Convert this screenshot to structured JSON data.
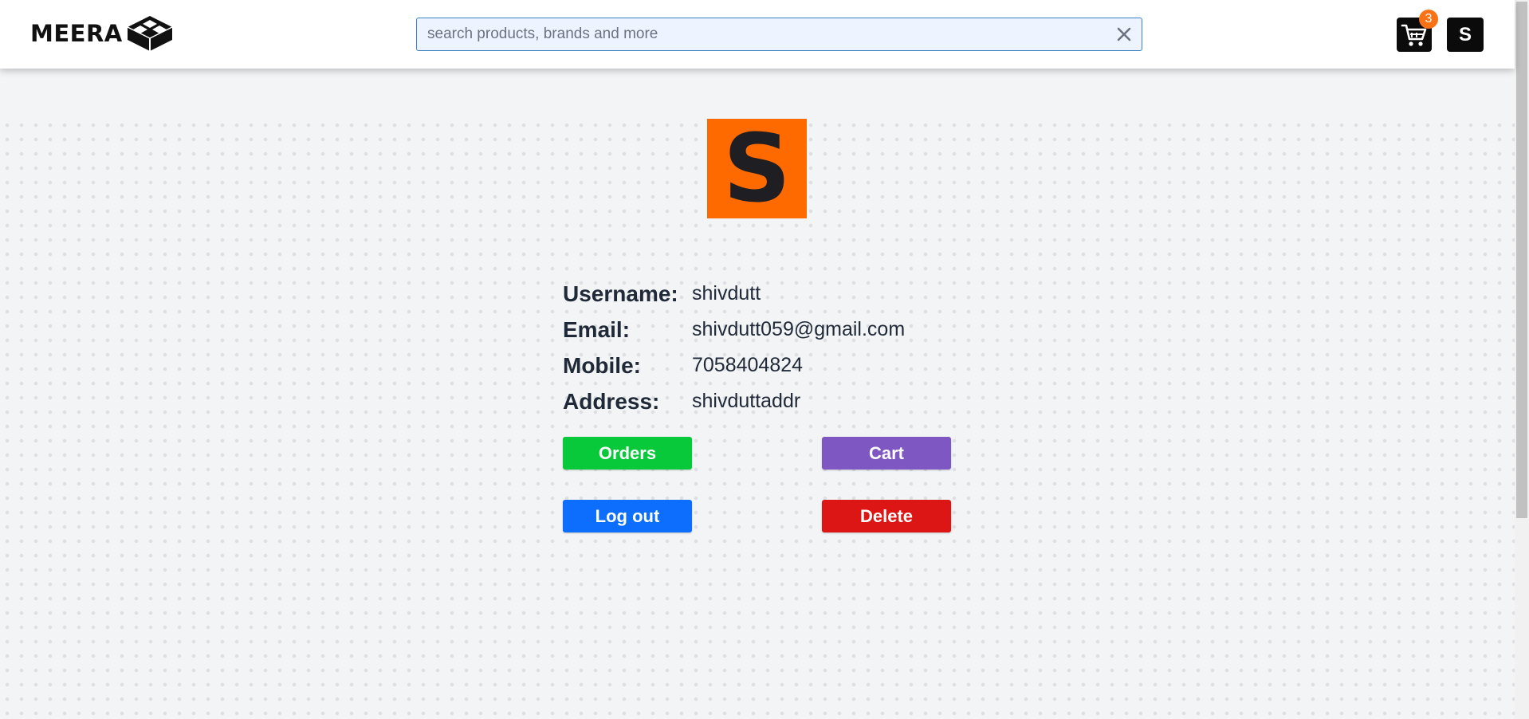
{
  "header": {
    "logo_text": "MEERA",
    "search": {
      "placeholder": "search products, brands and more",
      "value": ""
    },
    "cart_count": "3",
    "user_initial": "S"
  },
  "profile": {
    "avatar_initial": "S",
    "fields": [
      {
        "label": "Username:",
        "value": "shivdutt"
      },
      {
        "label": "Email:",
        "value": "shivdutt059@gmail.com"
      },
      {
        "label": "Mobile:",
        "value": "7058404824"
      },
      {
        "label": "Address:",
        "value": "shivduttaddr"
      }
    ],
    "buttons": {
      "orders": "Orders",
      "cart": "Cart",
      "logout": "Log out",
      "delete": "Delete"
    }
  },
  "colors": {
    "avatar_bg": "#ff6a00",
    "orders": "#08c93a",
    "cart": "#7e57c2",
    "logout": "#0d6efd",
    "delete": "#dc1515",
    "badge": "#f97316"
  },
  "icons": {
    "logo": "box-icon",
    "clear": "close-icon",
    "cart": "cart-icon"
  }
}
